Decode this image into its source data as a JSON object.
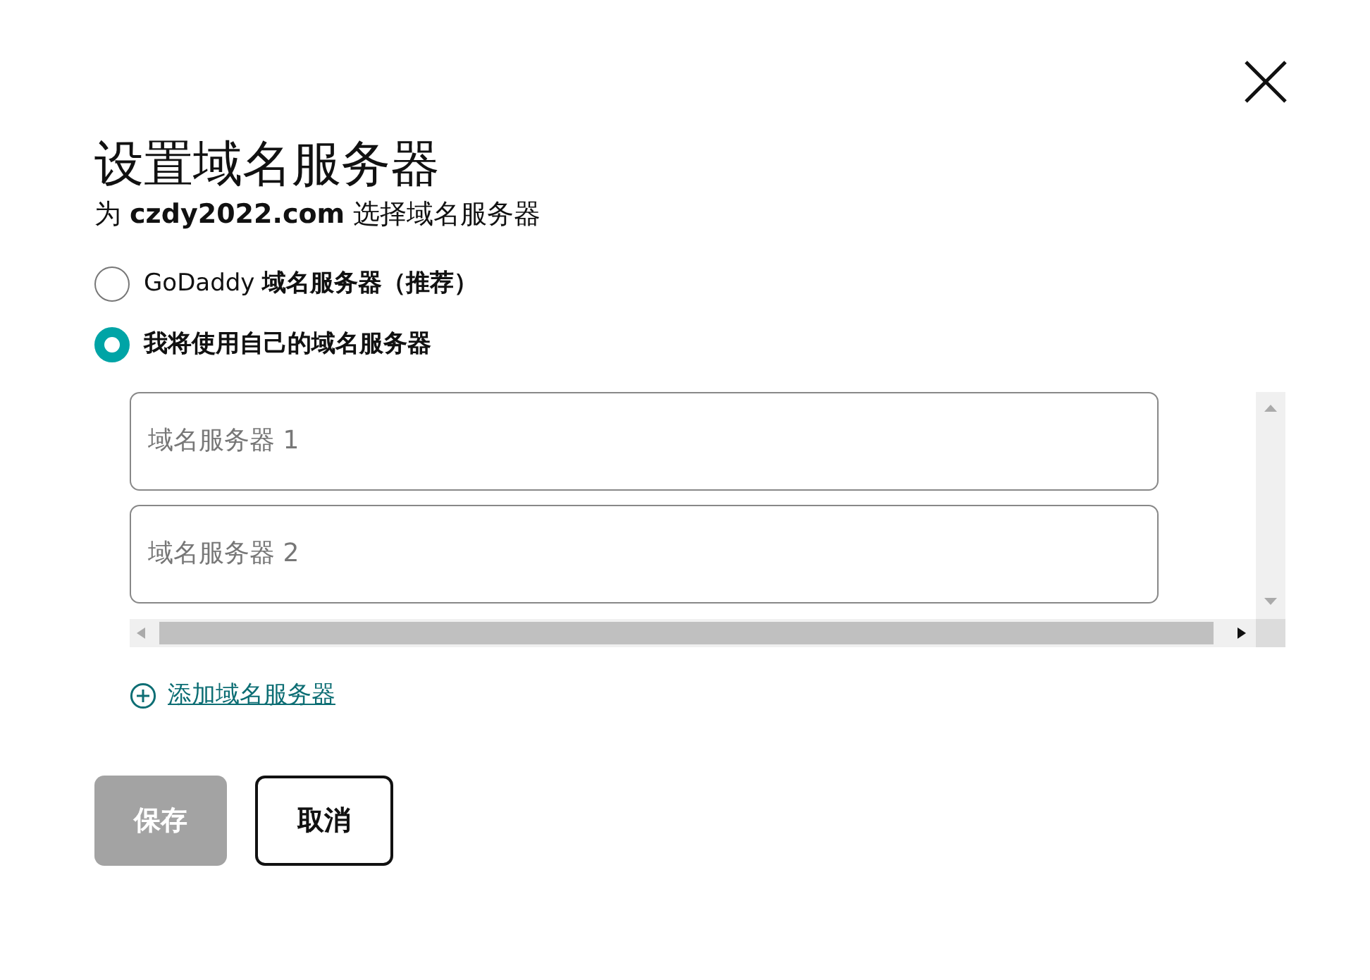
{
  "dialog": {
    "title": "设置域名服务器",
    "subtitle": "为 **czdy2022.com** 选择域名服务器"
  },
  "options": [
    {
      "label": "GoDaddy **域名服务器（推荐）**",
      "selected": false
    },
    {
      "label": "我将使用自己的域名服务器",
      "selected": true
    }
  ],
  "nameserver_fields": [
    {
      "placeholder": "域名服务器 1"
    },
    {
      "placeholder": "域名服务器 2"
    }
  ],
  "add_link": "添加域名服务器",
  "buttons": [
    {
      "label": "保存",
      "kind": "primary",
      "disabled": true
    },
    {
      "label": "取消",
      "kind": "secondary",
      "disabled": false
    }
  ]
}
